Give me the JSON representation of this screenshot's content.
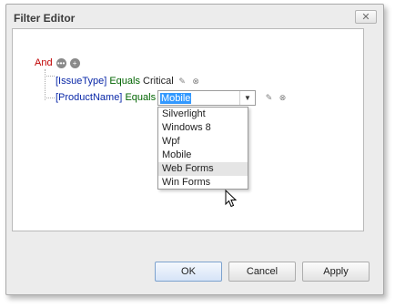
{
  "window": {
    "title": "Filter Editor",
    "close_glyph": "✕"
  },
  "tree": {
    "group_operator": "And",
    "conditions": [
      {
        "field": "[IssueType]",
        "operator": "Equals",
        "value": "Critical"
      },
      {
        "field": "[ProductName]",
        "operator": "Equals",
        "value": "Mobile"
      }
    ]
  },
  "dropdown": {
    "selected": "Mobile",
    "options": [
      "Silverlight",
      "Windows 8",
      "Wpf",
      "Mobile",
      "Web Forms",
      "Win Forms"
    ],
    "hovered": "Web Forms"
  },
  "buttons": {
    "ok": "OK",
    "cancel": "Cancel",
    "apply": "Apply"
  },
  "icons": {
    "add_condition": "ellipsis-circle-icon",
    "add_group": "plus-circle-icon",
    "edit": "pencil-icon",
    "remove": "remove-circle-icon"
  },
  "colors": {
    "group_operator": "#c00000",
    "field": "#0a28a8",
    "operator": "#006400",
    "selection": "#3399ff"
  }
}
